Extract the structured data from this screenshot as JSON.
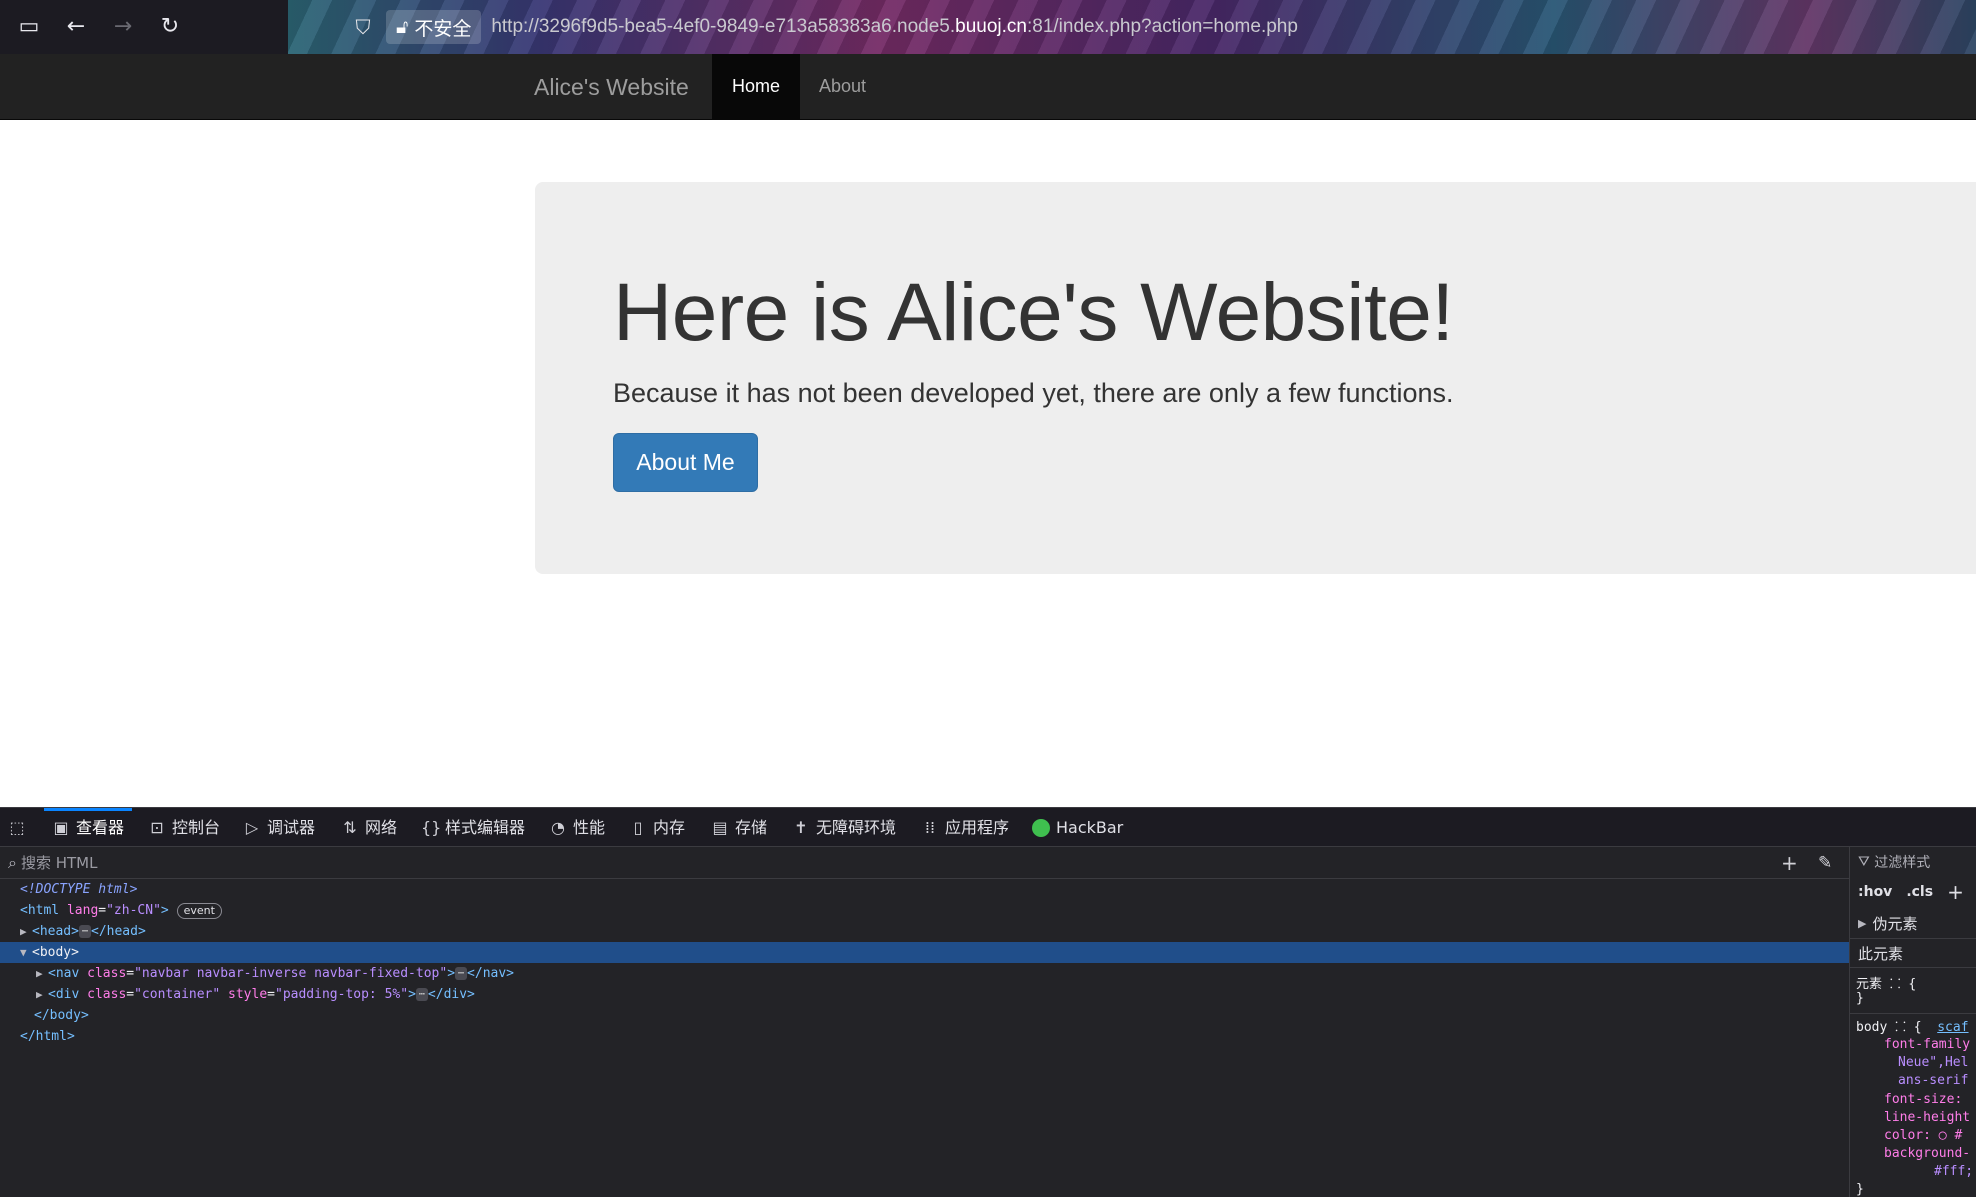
{
  "browser": {
    "sidebar_icon": "sidebar-icon",
    "back_icon": "arrow-left-icon",
    "forward_icon": "arrow-right-icon",
    "reload_icon": "reload-icon",
    "security_label": "不安全",
    "url_prefix": "http://3296f9d5-bea5-4ef0-9849-e713a58383a6.node5.",
    "url_domain": "buuoj.cn",
    "url_suffix": ":81/index.php?action=home.php"
  },
  "site": {
    "brand": "Alice's Website",
    "nav": [
      {
        "label": "Home",
        "active": true
      },
      {
        "label": "About",
        "active": false
      }
    ],
    "jumbotron": {
      "heading": "Here is Alice's Website!",
      "text": "Because it has not been developed yet, there are only a few functions.",
      "button": "About Me"
    },
    "colors": {
      "navbar": "#222222",
      "jumbotron": "#eeeeee",
      "button": "#337ab7"
    }
  },
  "devtools": {
    "tabs": [
      {
        "label": "查看器",
        "icon": "inspector-icon",
        "active": true
      },
      {
        "label": "控制台",
        "icon": "console-icon"
      },
      {
        "label": "调试器",
        "icon": "debugger-icon"
      },
      {
        "label": "网络",
        "icon": "network-icon"
      },
      {
        "label": "样式编辑器",
        "icon": "style-editor-icon"
      },
      {
        "label": "性能",
        "icon": "performance-icon"
      },
      {
        "label": "内存",
        "icon": "memory-icon"
      },
      {
        "label": "存储",
        "icon": "storage-icon"
      },
      {
        "label": "无障碍环境",
        "icon": "accessibility-icon"
      },
      {
        "label": "应用程序",
        "icon": "application-icon"
      },
      {
        "label": "HackBar",
        "icon": "hackbar-icon"
      }
    ],
    "search_placeholder": "搜索 HTML",
    "html": {
      "doctype": "<!DOCTYPE html>",
      "html_open_tag": "<html",
      "html_lang_attr": "lang",
      "html_lang_val": "\"zh-CN\"",
      "event_badge": "event",
      "head_open": "<head>",
      "head_close": "</head>",
      "body_open": "<body>",
      "nav_open": "<nav",
      "nav_class_attr": "class",
      "nav_class_val": "\"navbar navbar-inverse navbar-fixed-top\"",
      "nav_close": "</nav>",
      "div_open": "<div",
      "div_class_attr": "class",
      "div_class_val": "\"container\"",
      "div_style_attr": "style",
      "div_style_val": "\"padding-top: 5%\"",
      "div_close": "</div>",
      "body_close": "</body>",
      "html_close": "</html>",
      "ellipsis": "⋯"
    },
    "styles": {
      "filter_placeholder": "过滤样式",
      "hov": ":hov",
      "cls": ".cls",
      "pseudo": "伪元素",
      "this_element": "此元素",
      "element_rule": "元素 ⸬ {",
      "close_brace": "}",
      "body_rule": "body ⸬ {",
      "body_source": "scaf",
      "decl_font_family": "font-family",
      "decl_font_family_v1": "Neue\",Hel",
      "decl_font_family_v2": "ans-serif",
      "decl_font_size": "font-size:",
      "decl_line_height": "line-height",
      "decl_color": "color: ◯ #",
      "decl_background": "background-",
      "decl_background_v": "#fff;"
    }
  }
}
